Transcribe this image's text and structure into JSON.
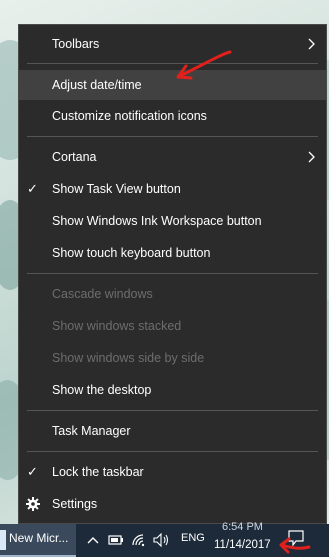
{
  "menu": {
    "items": [
      {
        "label": "Toolbars",
        "submenu": true,
        "checked": false,
        "disabled": false
      },
      {
        "label": "Adjust date/time",
        "submenu": false,
        "checked": false,
        "disabled": false,
        "highlighted": true
      },
      {
        "label": "Customize notification icons",
        "submenu": false,
        "checked": false,
        "disabled": false
      },
      {
        "label": "Cortana",
        "submenu": true,
        "checked": false,
        "disabled": false
      },
      {
        "label": "Show Task View button",
        "submenu": false,
        "checked": true,
        "disabled": false
      },
      {
        "label": "Show Windows Ink Workspace button",
        "submenu": false,
        "checked": false,
        "disabled": false
      },
      {
        "label": "Show touch keyboard button",
        "submenu": false,
        "checked": false,
        "disabled": false
      },
      {
        "label": "Cascade windows",
        "submenu": false,
        "checked": false,
        "disabled": true
      },
      {
        "label": "Show windows stacked",
        "submenu": false,
        "checked": false,
        "disabled": true
      },
      {
        "label": "Show windows side by side",
        "submenu": false,
        "checked": false,
        "disabled": true
      },
      {
        "label": "Show the desktop",
        "submenu": false,
        "checked": false,
        "disabled": false
      },
      {
        "label": "Task Manager",
        "submenu": false,
        "checked": false,
        "disabled": false
      },
      {
        "label": "Lock the taskbar",
        "submenu": false,
        "checked": true,
        "disabled": false
      },
      {
        "label": "Settings",
        "submenu": false,
        "checked": false,
        "disabled": false,
        "icon": "gear-icon"
      }
    ],
    "check_glyph": "✓"
  },
  "taskbar": {
    "app_label": "New Micr...",
    "tray_icons": [
      "chevron-up-icon",
      "battery-icon",
      "wifi-icon",
      "volume-icon"
    ],
    "language": "ENG",
    "time": "6:54 PM",
    "date": "11/14/2017",
    "notification_icon": "action-center-icon"
  },
  "colors": {
    "menu_bg": "#2b2b2b",
    "menu_hover": "#414141",
    "menu_text": "#ffffff",
    "menu_disabled": "#6d6d6d",
    "annotation": "#e0201c",
    "taskbar_bg": "#1c2a3a"
  }
}
